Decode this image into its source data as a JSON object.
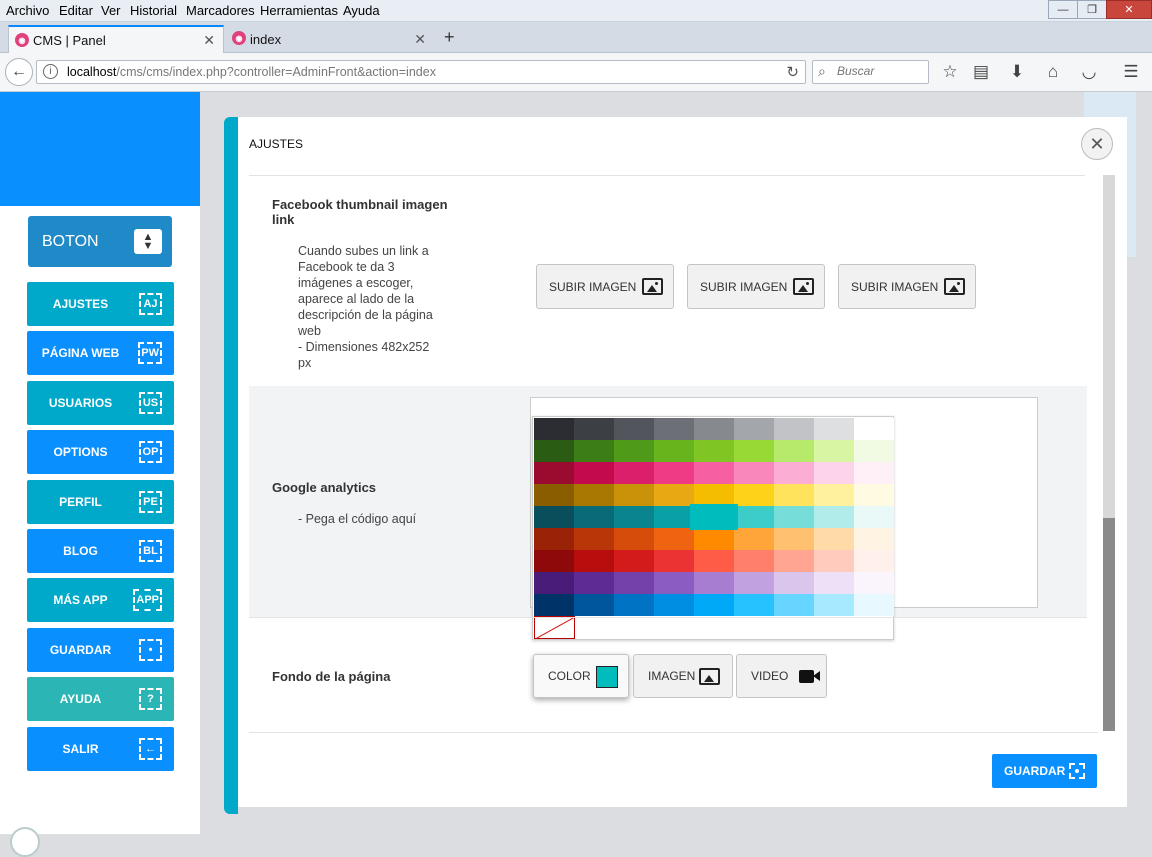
{
  "menubar": {
    "items": [
      "Archivo",
      "Editar",
      "Ver",
      "Historial",
      "Marcadores",
      "Herramientas",
      "Ayuda"
    ]
  },
  "window": {
    "minimize": "—",
    "maximize": "❐",
    "close": "✕"
  },
  "tabs": [
    {
      "label": "CMS | Panel",
      "active": true
    },
    {
      "label": "index",
      "active": false
    }
  ],
  "navbar": {
    "url_host": "localhost",
    "url_path": "/cms/cms/index.php?controller=AdminFront&action=index",
    "search_placeholder": "Buscar"
  },
  "sidebar": {
    "boton_label": "BOTON",
    "items": [
      {
        "label": "AJUSTES",
        "code": "AJ",
        "color": "#00a9c9"
      },
      {
        "label": "PÁGINA WEB",
        "code": "PW",
        "color": "#0a8fff"
      },
      {
        "label": "USUARIOS",
        "code": "US",
        "color": "#00a9c9"
      },
      {
        "label": "OPTIONS",
        "code": "OP",
        "color": "#0a8fff"
      },
      {
        "label": "PERFIL",
        "code": "PE",
        "color": "#00a9c9"
      },
      {
        "label": "BLOG",
        "code": "BL",
        "color": "#0a8fff"
      },
      {
        "label": "MÁS APP",
        "code": "APP",
        "color": "#00a9c9"
      },
      {
        "label": "GUARDAR",
        "code": "•",
        "color": "#0a8fff"
      },
      {
        "label": "AYUDA",
        "code": "?",
        "color": "#2bb5b4"
      },
      {
        "label": "SALIR",
        "code": "←",
        "color": "#0a8fff"
      }
    ]
  },
  "modal": {
    "title": "AJUSTES",
    "facebook": {
      "label_line1": "Facebook thumbnail imagen",
      "label_line2": "link",
      "desc_lines": [
        "Cuando subes un link a",
        "Facebook te da 3",
        "imágenes a escoger,",
        "aparece al lado de la",
        "descripción de la página",
        "web",
        "- Dimensiones 482x252",
        "px"
      ],
      "upload_label": "SUBIR IMAGEN"
    },
    "analytics": {
      "label": "Google analytics",
      "desc": "- Pega el código aquí"
    },
    "background": {
      "label": "Fondo de la página",
      "color_label": "COLOR",
      "image_label": "IMAGEN",
      "video_label": "VIDEO",
      "selected_color": "#00bcbc"
    },
    "save_label": "GUARDAR"
  },
  "palette": [
    [
      "#2b2d33",
      "#3c4045",
      "#52565c",
      "#6c7076",
      "#868a8f",
      "#a3a6aa",
      "#c1c3c6",
      "#dddfe1",
      "#ffffff"
    ],
    [
      "#2a5c14",
      "#3c7d15",
      "#4f9a18",
      "#67b41d",
      "#7fc624",
      "#99d936",
      "#b7e96a",
      "#d7f5a3",
      "#f1fbe4"
    ],
    [
      "#9b0a2f",
      "#c30a4c",
      "#db1f6a",
      "#ef3b86",
      "#f65fa1",
      "#fa87bb",
      "#fcadd3",
      "#fdd3e9",
      "#fff0f7"
    ],
    [
      "#8a5e00",
      "#a97800",
      "#c99208",
      "#e7a813",
      "#f5bd00",
      "#ffd21a",
      "#ffe35c",
      "#fff19d",
      "#fffbe2"
    ],
    [
      "#0a4e5c",
      "#0a6b78",
      "#0a8590",
      "#0aa0a8",
      "#00bcbc",
      "#3ccdc9",
      "#76ddd8",
      "#b1ecea",
      "#e9f9f8"
    ],
    [
      "#9a2206",
      "#b93609",
      "#d64c0a",
      "#ee6410",
      "#ff8a00",
      "#ffa53a",
      "#ffc06f",
      "#ffdba8",
      "#fff3e3"
    ],
    [
      "#8e0a0a",
      "#b70d0d",
      "#d41b1b",
      "#ec3333",
      "#ff5c48",
      "#ff7f6a",
      "#ffa592",
      "#ffcbbd",
      "#fff0eb"
    ],
    [
      "#4a1c7a",
      "#5e2a93",
      "#7440aa",
      "#8b5cc1",
      "#a67dd1",
      "#c2a1e0",
      "#dac5ed",
      "#eee0f7",
      "#faf4fd"
    ],
    [
      "#003468",
      "#00569a",
      "#0073c4",
      "#008ee3",
      "#00a8f8",
      "#26c1ff",
      "#66d5ff",
      "#a7eaff",
      "#e7f8ff"
    ]
  ]
}
